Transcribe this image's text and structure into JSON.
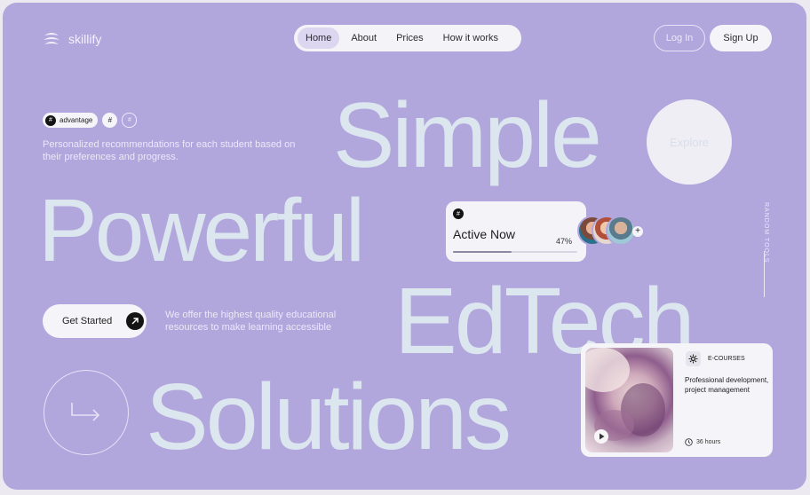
{
  "brand": {
    "name": "skillify"
  },
  "nav": {
    "items": [
      {
        "label": "Home",
        "active": true
      },
      {
        "label": "About"
      },
      {
        "label": "Prices"
      },
      {
        "label": "How it works"
      }
    ]
  },
  "auth": {
    "login_label": "Log In",
    "signup_label": "Sign Up"
  },
  "hero": {
    "chips": {
      "hash": "#",
      "tag": "advantage",
      "hash2": "#",
      "circle": "#"
    },
    "description": "Personalized recommendations for each student based on their preferences and progress.",
    "words": {
      "simple": "Simple",
      "powerful": "Powerful",
      "edtech": "EdTech",
      "solutions": "Solutions"
    },
    "explore_label": "Explore",
    "cta_label": "Get Started",
    "offer_text": "We offer the highest quality educational resources to make learning accessible",
    "side_label": "RANDOM TOOLS"
  },
  "active_card": {
    "title": "Active Now",
    "progress_text": "47%",
    "progress_fraction": 0.47,
    "plus": "+"
  },
  "course_card": {
    "tag": "E-COURSES",
    "title": "Professional development, project management",
    "hours": "36 hours"
  },
  "colors": {
    "background": "#b2a7dd",
    "headline": "#dce6ee",
    "surface": "#f5f4f8",
    "dark": "#141414"
  },
  "icons": [
    "logo-mark-icon",
    "hash-icon",
    "arrow-up-right-icon",
    "arrow-return-icon",
    "gear-icon",
    "play-icon",
    "clock-icon",
    "plus-icon"
  ]
}
